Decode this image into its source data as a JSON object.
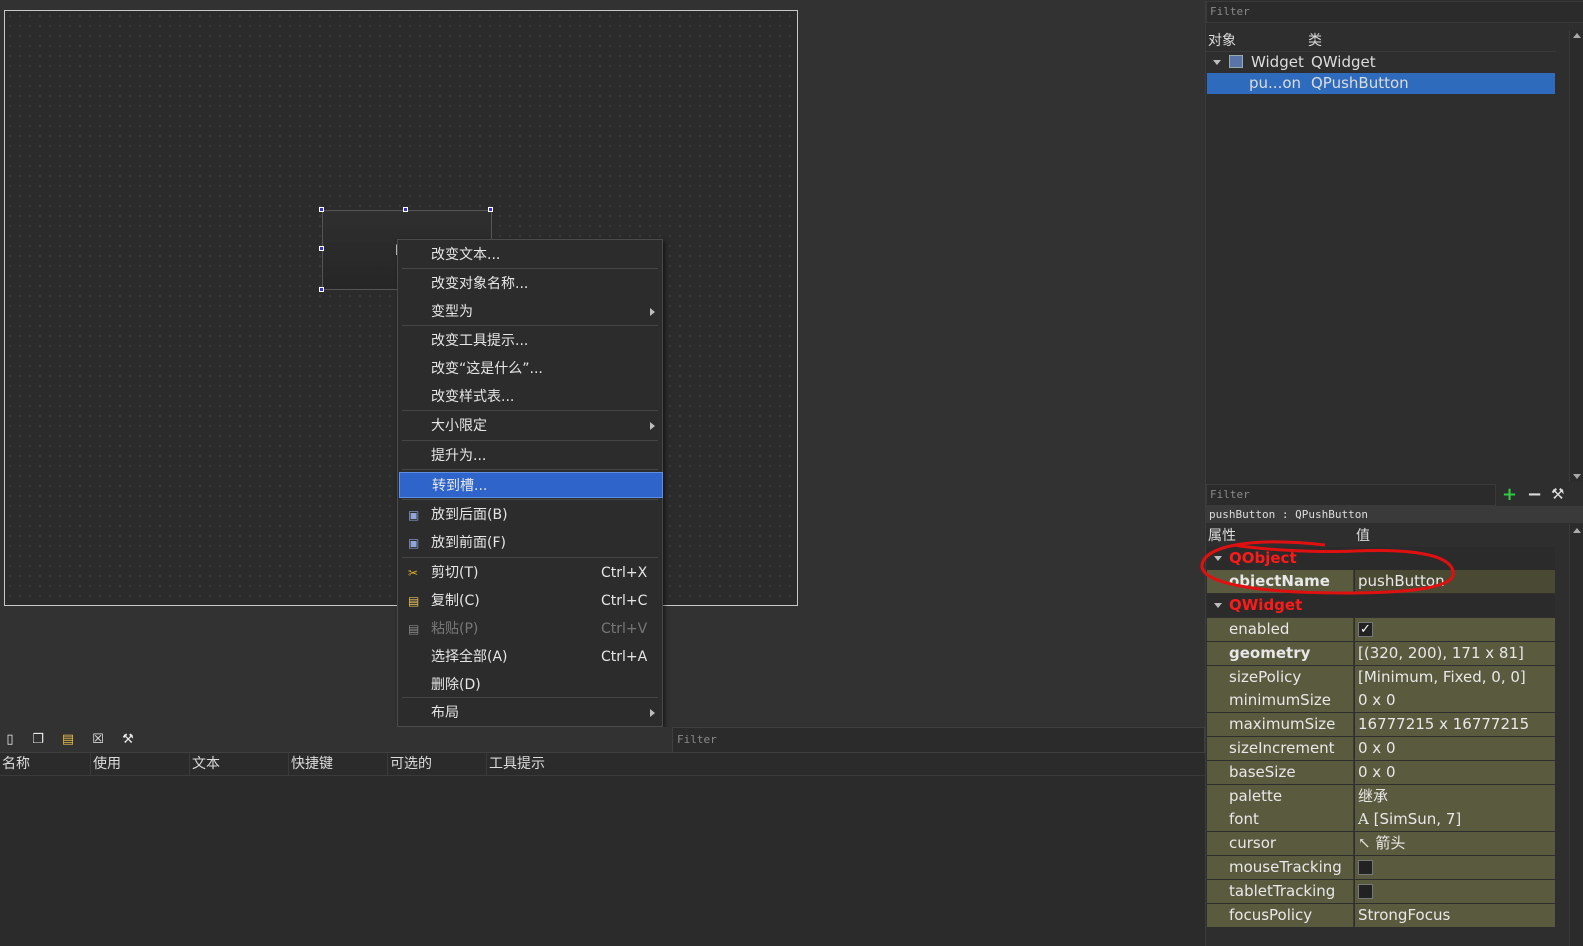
{
  "canvas": {
    "button_partial_text": "p"
  },
  "context_menu": {
    "items": [
      {
        "label": "改变文本...",
        "shortcut": "",
        "submenu": false,
        "icon": ""
      },
      {
        "label": "改变对象名称...",
        "shortcut": "",
        "submenu": false,
        "icon": ""
      },
      {
        "label": "变型为",
        "shortcut": "",
        "submenu": true,
        "icon": ""
      },
      {
        "label": "改变工具提示...",
        "shortcut": "",
        "submenu": false,
        "icon": ""
      },
      {
        "label": "改变“这是什么”...",
        "shortcut": "",
        "submenu": false,
        "icon": ""
      },
      {
        "label": "改变样式表...",
        "shortcut": "",
        "submenu": false,
        "icon": ""
      },
      {
        "label": "大小限定",
        "shortcut": "",
        "submenu": true,
        "icon": ""
      },
      {
        "label": "提升为...",
        "shortcut": "",
        "submenu": false,
        "icon": ""
      },
      {
        "label": "转到槽...",
        "shortcut": "",
        "submenu": false,
        "icon": "",
        "highlighted": true
      },
      {
        "label": "放到后面(B)",
        "shortcut": "",
        "submenu": false,
        "icon": "send-back-icon"
      },
      {
        "label": "放到前面(F)",
        "shortcut": "",
        "submenu": false,
        "icon": "bring-front-icon"
      },
      {
        "label": "剪切(T)",
        "shortcut": "Ctrl+X",
        "submenu": false,
        "icon": "scissors-icon"
      },
      {
        "label": "复制(C)",
        "shortcut": "Ctrl+C",
        "submenu": false,
        "icon": "copy-icon"
      },
      {
        "label": "粘贴(P)",
        "shortcut": "Ctrl+V",
        "submenu": false,
        "icon": "paste-icon",
        "disabled": true
      },
      {
        "label": "选择全部(A)",
        "shortcut": "Ctrl+A",
        "submenu": false,
        "icon": ""
      },
      {
        "label": "删除(D)",
        "shortcut": "",
        "submenu": false,
        "icon": ""
      },
      {
        "label": "布局",
        "shortcut": "",
        "submenu": true,
        "icon": ""
      }
    ]
  },
  "action_editor": {
    "filter_placeholder": "Filter",
    "columns": [
      "名称",
      "使用",
      "文本",
      "快捷键",
      "可选的",
      "工具提示"
    ],
    "toolbar_icons": [
      "new-action-icon",
      "copy-action-icon",
      "paste-action-icon",
      "delete-action-icon",
      "configure-icon"
    ]
  },
  "object_inspector": {
    "filter_placeholder": "Filter",
    "col_object": "对象",
    "col_class": "类",
    "rows": [
      {
        "object": "Widget",
        "class": "QWidget",
        "selected": false
      },
      {
        "object": "pu...on",
        "class": "QPushButton",
        "selected": true
      }
    ]
  },
  "property_editor": {
    "filter_placeholder": "Filter",
    "subtitle": "pushButton : QPushButton",
    "col_property": "属性",
    "col_value": "值",
    "groups": [
      {
        "name": "QObject",
        "props": [
          {
            "name": "objectName",
            "value": "pushButton",
            "bold": true,
            "expandable": false
          }
        ]
      },
      {
        "name": "QWidget",
        "props": [
          {
            "name": "enabled",
            "value": "✓",
            "type": "checkbox",
            "expandable": false
          },
          {
            "name": "geometry",
            "value": "[(320, 200), 171 x 81]",
            "bold": true,
            "expandable": true
          },
          {
            "name": "sizePolicy",
            "value": "[Minimum, Fixed, 0, 0]",
            "expandable": true
          },
          {
            "name": "minimumSize",
            "value": "0 x 0",
            "expandable": true
          },
          {
            "name": "maximumSize",
            "value": "16777215 x 16777215",
            "expandable": true
          },
          {
            "name": "sizeIncrement",
            "value": "0 x 0",
            "expandable": true
          },
          {
            "name": "baseSize",
            "value": "0 x 0",
            "expandable": true
          },
          {
            "name": "palette",
            "value": "继承",
            "expandable": false
          },
          {
            "name": "font",
            "value": "[SimSun, 7]",
            "icon": "font-icon",
            "expandable": true
          },
          {
            "name": "cursor",
            "value": "箭头",
            "icon": "arrow-cursor-icon",
            "expandable": false
          },
          {
            "name": "mouseTracking",
            "value": "",
            "type": "checkbox",
            "expandable": false
          },
          {
            "name": "tabletTracking",
            "value": "",
            "type": "checkbox",
            "expandable": false
          },
          {
            "name": "focusPolicy",
            "value": "StrongFocus",
            "expandable": false
          }
        ]
      }
    ]
  },
  "colors": {
    "highlight": "#2f65ca",
    "group_header": "#ff1a1a",
    "property_bg": "#5a5a3f",
    "annotation": "#e01010"
  }
}
